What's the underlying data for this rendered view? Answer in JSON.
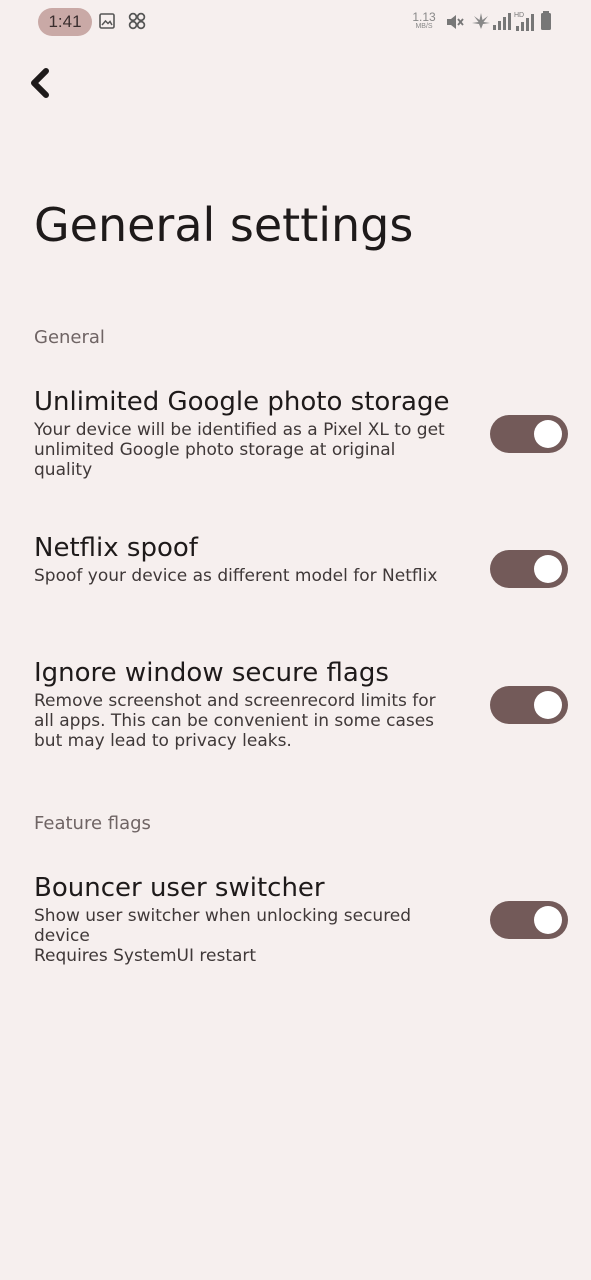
{
  "status_bar": {
    "time": "1:41",
    "net_speed_value": "1.13",
    "net_speed_unit": "MB/S"
  },
  "header": {
    "back_icon": "chevron-left-icon",
    "title": "General settings"
  },
  "sections": [
    {
      "header": "General",
      "items": [
        {
          "title": "Unlimited Google photo storage",
          "summary": "Your device will be identified as a Pixel XL to get unlimited Google photo storage at original quality",
          "enabled": true
        },
        {
          "title": "Netflix spoof",
          "summary": "Spoof your device as different model for Netflix",
          "enabled": true
        },
        {
          "title": "Ignore window secure flags",
          "summary": "Remove screenshot and screenrecord limits for all apps. This can be convenient in some cases but may lead to privacy leaks.",
          "enabled": true
        }
      ]
    },
    {
      "header": "Feature flags",
      "items": [
        {
          "title": "Bouncer user switcher",
          "summary_line1": "Show user switcher when unlocking secured device",
          "summary_line2": "Requires SystemUI restart",
          "enabled": true
        }
      ]
    }
  ],
  "colors": {
    "background": "#f6efee",
    "toggle_track_on": "#735a59",
    "toggle_knob": "#ffffff",
    "time_pill": "#c9a9a6"
  }
}
